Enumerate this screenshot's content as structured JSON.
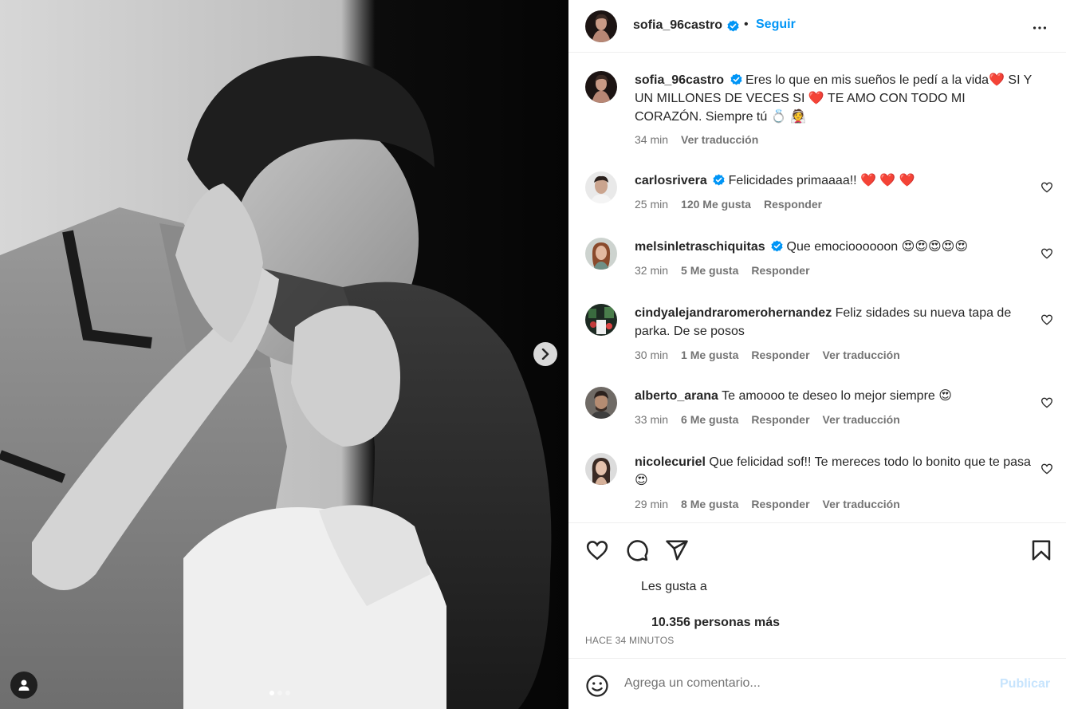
{
  "post": {
    "author": "sofia_96castro",
    "follow_label": "Seguir",
    "separator": "•",
    "more_icon": "more-horizontal-icon",
    "caption": "Eres lo que en mis sueños le pedí a la vida❤️ SI Y UN MILLONES DE VECES SI ❤️  TE AMO CON TODO MI CORAZÓN. Siempre tú 💍 👰",
    "caption_time": "34 min",
    "caption_translate": "Ver traducción"
  },
  "comments": [
    {
      "user": "carlosrivera",
      "verified": true,
      "text": "Felicidades primaaaa!! ❤️ ❤️ ❤️",
      "time": "25 min",
      "likes": "120 Me gusta",
      "reply": "Responder",
      "translate": ""
    },
    {
      "user": "melsinletraschiquitas",
      "verified": true,
      "text": "Que emocioooooon 😍😍😍😍😍",
      "time": "32 min",
      "likes": "5 Me gusta",
      "reply": "Responder",
      "translate": ""
    },
    {
      "user": "cindyalejandraromerohernandez",
      "verified": false,
      "text": "Feliz sidades su nueva tapa de parka. De se posos",
      "time": "30 min",
      "likes": "1 Me gusta",
      "reply": "Responder",
      "translate": "Ver traducción"
    },
    {
      "user": "alberto_arana",
      "verified": false,
      "text": "Te amoooo te deseo lo mejor siempre 😍",
      "time": "33 min",
      "likes": "6 Me gusta",
      "reply": "Responder",
      "translate": "Ver traducción"
    },
    {
      "user": "nicolecuriel",
      "verified": false,
      "text": "Que felicidad sof!! Te mereces todo lo bonito que te pasa😍",
      "time": "29 min",
      "likes": "8 Me gusta",
      "reply": "Responder",
      "translate": "Ver traducción"
    }
  ],
  "likes": {
    "liked_by_label": "Les gusta a",
    "others": "10.356 personas más"
  },
  "timestamp": "HACE 34 MINUTOS",
  "composer": {
    "placeholder": "Agrega un comentario...",
    "post_label": "Publicar"
  },
  "colors": {
    "accent": "#0095f6",
    "verified": "#0095f6",
    "heart": "#ed1b3a",
    "muted": "#737373",
    "post_disabled": "#c7e4fd"
  }
}
